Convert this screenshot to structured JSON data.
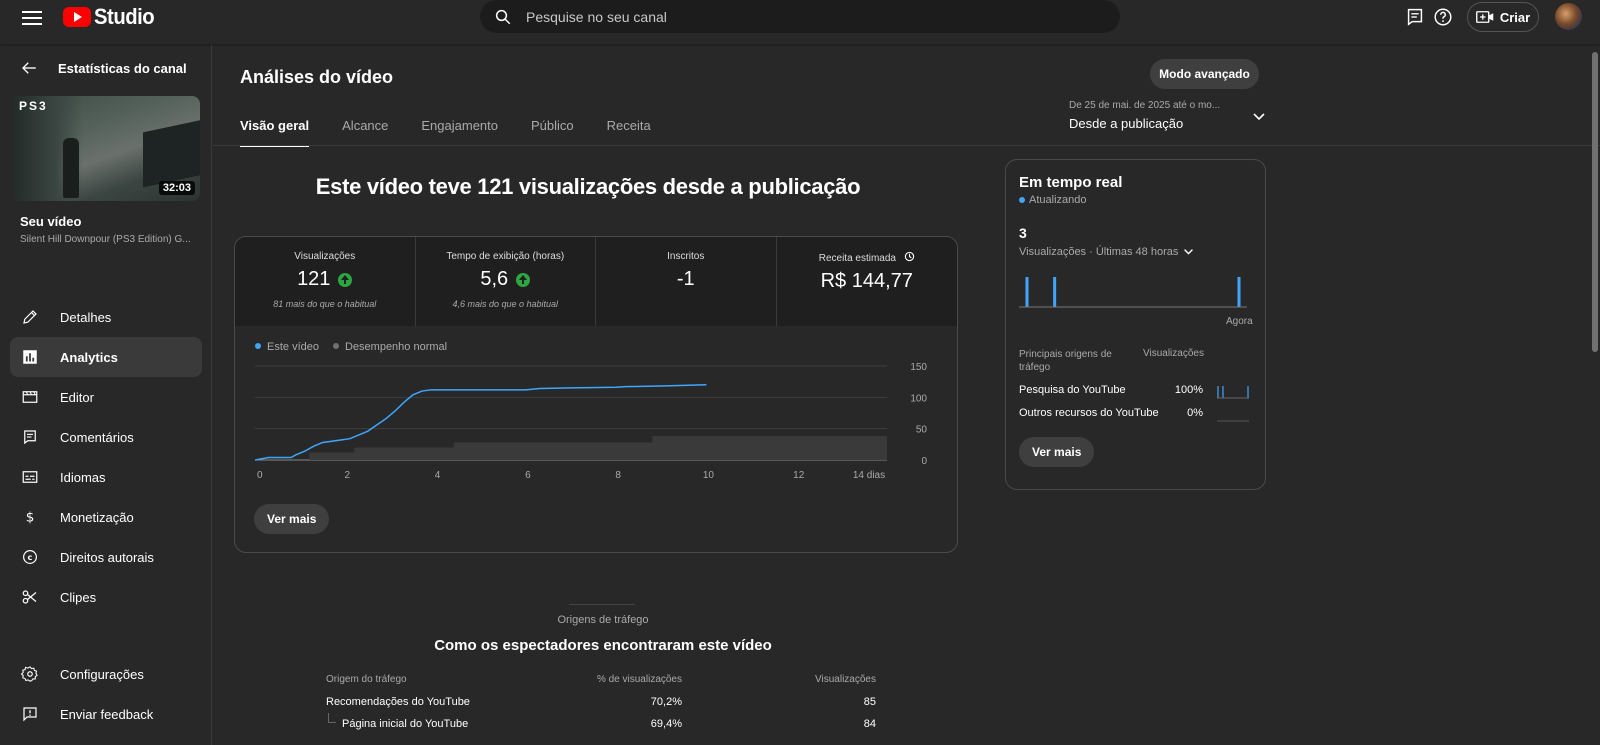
{
  "app": {
    "logo_text": "Studio"
  },
  "search": {
    "placeholder": "Pesquise no seu canal"
  },
  "header": {
    "create_label": "Criar"
  },
  "sidebar": {
    "back_label": "Estatísticas do canal",
    "thumbnail": {
      "badge": "PS3",
      "duration": "32:03"
    },
    "your_video_label": "Seu vídeo",
    "video_title": "Silent Hill Downpour (PS3 Edition) G...",
    "items": [
      {
        "label": "Detalhes",
        "icon": "pencil-icon"
      },
      {
        "label": "Analytics",
        "icon": "analytics-icon",
        "active": true
      },
      {
        "label": "Editor",
        "icon": "editor-icon"
      },
      {
        "label": "Comentários",
        "icon": "comments-icon"
      },
      {
        "label": "Idiomas",
        "icon": "subtitles-icon"
      },
      {
        "label": "Monetização",
        "icon": "dollar-icon"
      },
      {
        "label": "Direitos autorais",
        "icon": "copyright-icon"
      },
      {
        "label": "Clipes",
        "icon": "scissors-icon"
      }
    ],
    "bottom_items": [
      {
        "label": "Configurações",
        "icon": "gear-icon"
      },
      {
        "label": "Enviar feedback",
        "icon": "feedback-icon"
      }
    ]
  },
  "main": {
    "title": "Análises do vídeo",
    "advanced_mode_label": "Modo avançado",
    "tabs": [
      {
        "label": "Visão geral",
        "active": true
      },
      {
        "label": "Alcance"
      },
      {
        "label": "Engajamento"
      },
      {
        "label": "Público"
      },
      {
        "label": "Receita"
      }
    ],
    "date_range": {
      "detail": "De 25 de mai. de 2025 até o mo...",
      "label": "Desde a publicação"
    },
    "headline": "Este vídeo teve 121 visualizações desde a publicação",
    "metrics": [
      {
        "label": "Visualizações",
        "value": "121",
        "trend": "up",
        "note": "81 mais do que o habitual"
      },
      {
        "label": "Tempo de exibição (horas)",
        "value": "5,6",
        "trend": "up",
        "note": "4,6 mais do que o habitual"
      },
      {
        "label": "Inscritos",
        "value": "-1",
        "note": ""
      },
      {
        "label": "Receita estimada",
        "value": "R$ 144,77",
        "note": "",
        "has_clock_icon": true
      }
    ],
    "legend": [
      {
        "label": "Este vídeo",
        "color": "#3ea6ff"
      },
      {
        "label": "Desempenho normal",
        "color": "#717171"
      }
    ],
    "see_more_label": "Ver mais"
  },
  "chart_data": {
    "type": "line",
    "x_tick_labels": [
      "0",
      "2",
      "4",
      "6",
      "8",
      "10",
      "12",
      "14 dias"
    ],
    "x_ticks": [
      0,
      2,
      4,
      6,
      8,
      10,
      12,
      14
    ],
    "y_ticks": [
      0,
      50,
      100,
      150
    ],
    "xlim": [
      0,
      14
    ],
    "ylim": [
      0,
      150
    ],
    "series": [
      {
        "name": "Este vídeo",
        "color": "#3ea6ff",
        "x": [
          0,
          0.3,
          0.8,
          0.9,
          1.1,
          1.3,
          1.5,
          1.7,
          1.9,
          2.1,
          2.3,
          2.5,
          2.7,
          2.9,
          3.1,
          3.3,
          3.5,
          3.7,
          3.9,
          4.2,
          5,
          6,
          6.3,
          7,
          8,
          8.2,
          9,
          9.5,
          10
        ],
        "y": [
          0,
          4,
          4,
          8,
          14,
          22,
          28,
          30,
          32,
          34,
          40,
          46,
          56,
          66,
          78,
          92,
          104,
          110,
          112,
          112,
          112,
          112,
          114,
          115,
          116,
          117,
          118,
          119,
          120
        ]
      },
      {
        "name": "Desempenho normal",
        "color": "#3a3a3a",
        "x": [
          0,
          1.2,
          1.2,
          2.2,
          2.2,
          4.4,
          4.4,
          8.8,
          8.8,
          14
        ],
        "y": [
          0,
          0,
          12,
          12,
          20,
          20,
          28,
          28,
          38,
          38
        ]
      }
    ]
  },
  "realtime": {
    "title": "Em tempo real",
    "status": "Atualizando",
    "value": "3",
    "subtitle": "Visualizações · Últimas 48 horas",
    "spark_values": [
      1,
      0,
      0,
      0,
      0,
      0,
      1,
      0,
      0,
      0,
      0,
      0,
      0,
      0,
      0,
      0,
      0,
      0,
      0,
      0,
      0,
      0,
      0,
      0,
      0,
      0,
      0,
      0,
      0,
      0,
      0,
      0,
      0,
      0,
      0,
      0,
      0,
      0,
      0,
      0,
      0,
      0,
      0,
      0,
      0,
      0,
      1
    ],
    "axis_label": "Agora",
    "col_source": "Principais origens de tráfego",
    "col_views": "Visualizações",
    "sources": [
      {
        "name": "Pesquisa do YouTube",
        "pct": "100%"
      },
      {
        "name": "Outros recursos do YouTube",
        "pct": "0%"
      }
    ],
    "see_more_label": "Ver mais"
  },
  "traffic": {
    "subtitle": "Origens de tráfego",
    "title": "Como os espectadores encontraram este vídeo",
    "headers": [
      "Origem do tráfego",
      "% de visualizações",
      "Visualizações"
    ],
    "rows": [
      {
        "source": "Recomendações do YouTube",
        "pct": "70,2%",
        "views": "85"
      },
      {
        "source": "Página inicial do YouTube",
        "pct": "69,4%",
        "views": "84",
        "child": true
      }
    ]
  }
}
